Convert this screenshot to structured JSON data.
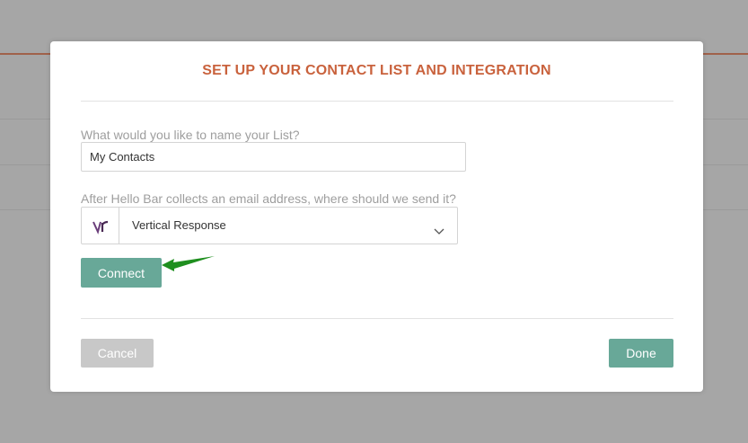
{
  "modal": {
    "title": "SET UP YOUR CONTACT LIST AND INTEGRATION",
    "list_name_label": "What would you like to name your List?",
    "list_name_value": "My Contacts",
    "destination_label": "After Hello Bar collects an email address, where should we send it?",
    "destination": {
      "selected": "Vertical Response",
      "logo_icon": "vertical-response-logo",
      "logo_text": "vr"
    },
    "connect_label": "Connect",
    "cancel_label": "Cancel",
    "done_label": "Done"
  },
  "colors": {
    "accent_title": "#c9623d",
    "primary_button": "#68a898",
    "disabled_button": "#c8c8c8",
    "annotation_arrow": "#1f8f1f"
  }
}
